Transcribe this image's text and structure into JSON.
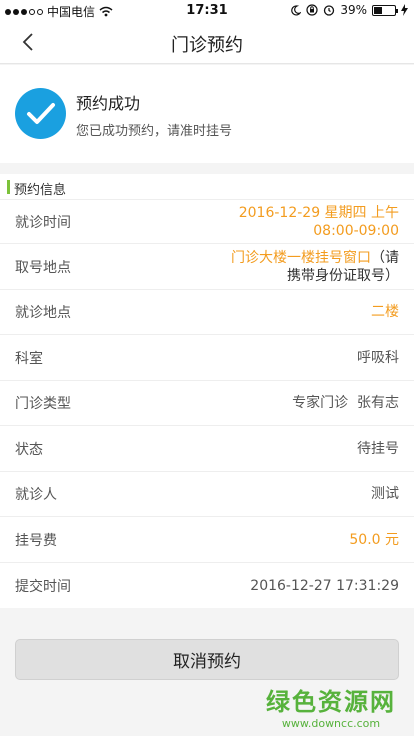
{
  "status_bar": {
    "carrier": "中国电信",
    "time": "17:31",
    "battery_percent": "39%",
    "battery_level": 0.39
  },
  "nav": {
    "title": "门诊预约"
  },
  "success": {
    "title": "预约成功",
    "subtitle": "您已成功预约，请准时挂号"
  },
  "info": {
    "header": "预约信息",
    "rows": {
      "visit_time": {
        "label": "就诊时间",
        "line1": "2016-12-29 星期四 上午",
        "line2": "08:00-09:00"
      },
      "pickup_location": {
        "label": "取号地点",
        "line1_orange": "门诊大楼一楼挂号窗口",
        "line1_dark": "（请",
        "line2": "携带身份证取号）"
      },
      "visit_location": {
        "label": "就诊地点",
        "value": "二楼"
      },
      "department": {
        "label": "科室",
        "value": "呼吸科"
      },
      "clinic_type": {
        "label": "门诊类型",
        "value": "专家门诊  张有志"
      },
      "status": {
        "label": "状态",
        "value": "待挂号"
      },
      "patient": {
        "label": "就诊人",
        "value": "测试"
      },
      "fee": {
        "label": "挂号费",
        "value": "50.0 元"
      },
      "submit_time": {
        "label": "提交时间",
        "value": "2016-12-27 17:31:29"
      }
    }
  },
  "cancel_button": "取消预约",
  "watermark": {
    "main": "绿色资源网",
    "url": "www.downcc.com"
  },
  "colors": {
    "accent_blue": "#1aa0e0",
    "accent_orange": "#f39c1f",
    "accent_green": "#7cc23a"
  }
}
